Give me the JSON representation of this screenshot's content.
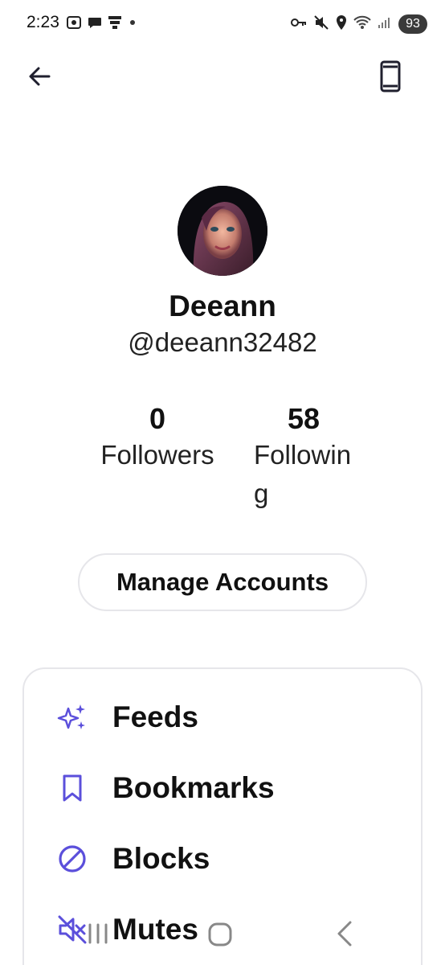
{
  "status_bar": {
    "time": "2:23",
    "left_icons": [
      "screenshot-icon",
      "chat-bubble-icon",
      "app-notification-icon",
      "dot-icon"
    ],
    "right_icons": [
      "vpn-key-icon",
      "mute-icon",
      "location-icon",
      "wifi-icon",
      "signal-icon"
    ],
    "battery": "93"
  },
  "header": {
    "back_icon": "arrow-left-icon",
    "device_icon": "smartphone-icon"
  },
  "profile": {
    "display_name": "Deeann",
    "handle": "@deeann32482"
  },
  "stats": {
    "followers_count": "0",
    "followers_label": "Followers",
    "following_count": "58",
    "following_label": "Following"
  },
  "manage_accounts_label": "Manage Accounts",
  "menu": {
    "accent_color": "#5b4fdb",
    "items": [
      {
        "icon": "sparkles-icon",
        "label": "Feeds"
      },
      {
        "icon": "bookmark-icon",
        "label": "Bookmarks"
      },
      {
        "icon": "block-icon",
        "label": "Blocks"
      },
      {
        "icon": "mute-speaker-icon",
        "label": "Mutes"
      }
    ]
  }
}
